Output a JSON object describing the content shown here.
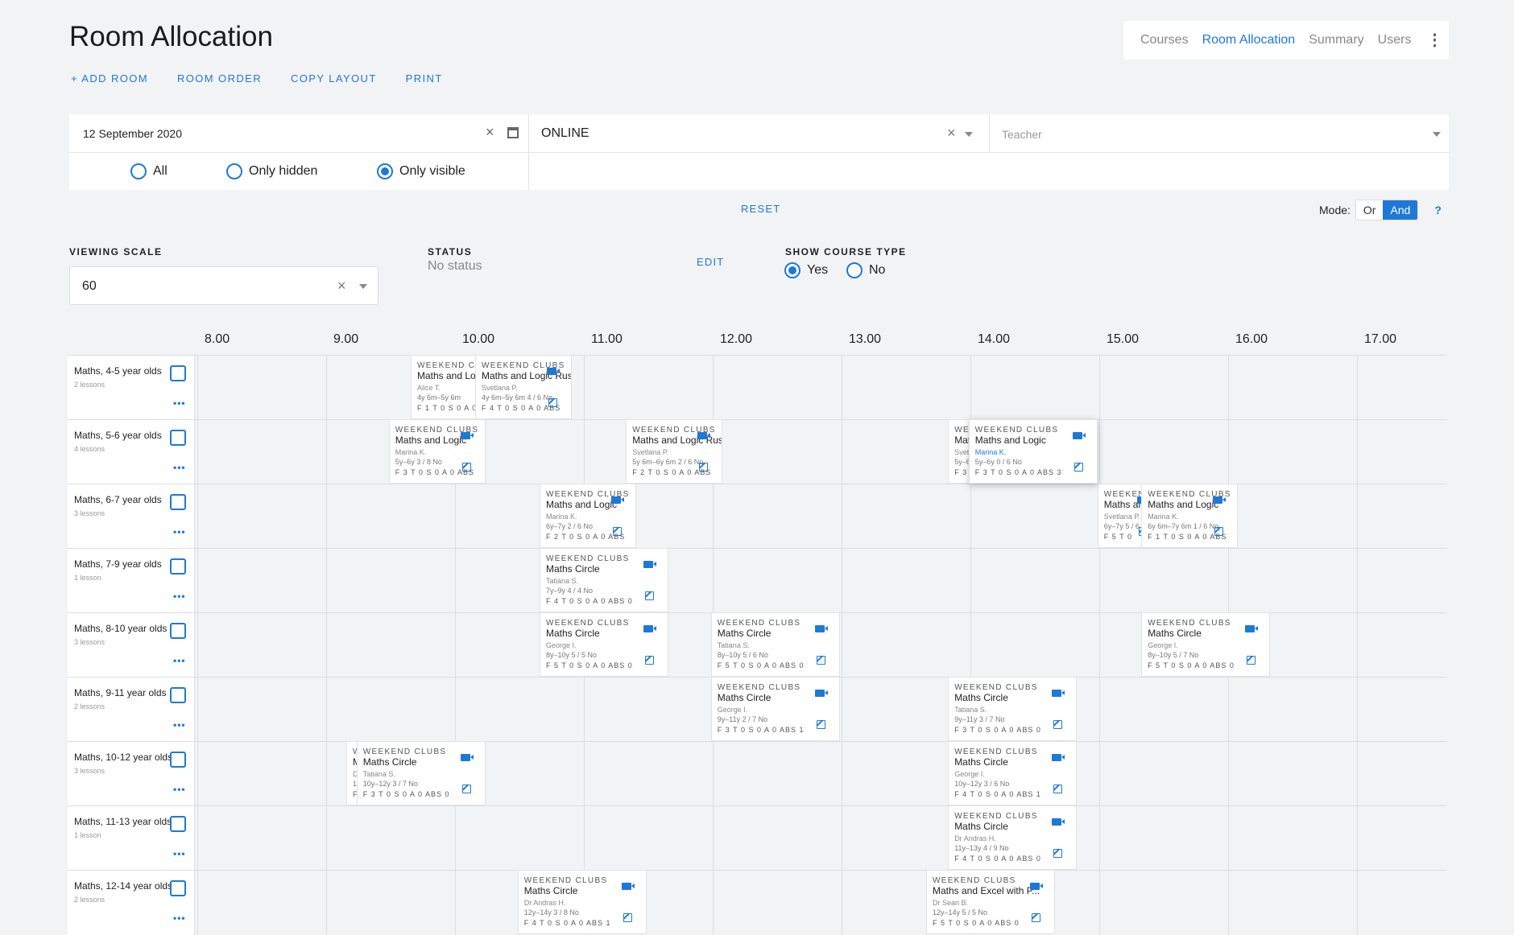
{
  "page": {
    "title": "Room Allocation"
  },
  "actions": [
    "+ ADD ROOM",
    "ROOM ORDER",
    "COPY LAYOUT",
    "PRINT"
  ],
  "nav": {
    "items": [
      "Courses",
      "Room Allocation",
      "Summary",
      "Users"
    ],
    "active": "Room Allocation"
  },
  "filters": {
    "date": "12 September 2020",
    "room": "ONLINE",
    "teacher_placeholder": "Teacher",
    "visibility": {
      "options": [
        "All",
        "Only hidden",
        "Only visible"
      ],
      "selected": "Only visible"
    }
  },
  "reset_label": "RESET",
  "mode": {
    "label": "Mode:",
    "options": [
      "Or",
      "And"
    ],
    "selected": "And",
    "help": "?"
  },
  "viewing_scale": {
    "label": "VIEWING SCALE",
    "value": "60"
  },
  "status": {
    "label": "STATUS",
    "value": "No status",
    "edit": "EDIT"
  },
  "show_course_type": {
    "label": "SHOW COURSE TYPE",
    "options": [
      "Yes",
      "No"
    ],
    "selected": "Yes"
  },
  "hours": [
    "8.00",
    "9.00",
    "10.00",
    "11.00",
    "12.00",
    "13.00",
    "14.00",
    "15.00",
    "16.00",
    "17.00"
  ],
  "rows": [
    {
      "name": "Maths, 4-5 year olds",
      "lessons": "2 lessons"
    },
    {
      "name": "Maths, 5-6 year olds",
      "lessons": "4 lessons"
    },
    {
      "name": "Maths, 6-7 year olds",
      "lessons": "3 lessons"
    },
    {
      "name": "Maths, 7-9 year olds",
      "lessons": "1 lesson"
    },
    {
      "name": "Maths, 8-10 year olds",
      "lessons": "3 lessons"
    },
    {
      "name": "Maths, 9-11 year olds",
      "lessons": "2 lessons"
    },
    {
      "name": "Maths, 10-12 year olds",
      "lessons": "3 lessons"
    },
    {
      "name": "Maths, 11-13 year olds",
      "lessons": "1 lesson"
    },
    {
      "name": "Maths, 12-14 year olds",
      "lessons": "2 lessons"
    }
  ],
  "lessons": [
    {
      "row": 0,
      "start": 9.5,
      "end": 10.25,
      "type": "WEEKEND CLUBS",
      "course": "Maths and Logic",
      "teacher": "Alice T.",
      "ages": "4y 6m–5y 6m",
      "stats": "F 1  T 0  S 0  A 0"
    },
    {
      "row": 0,
      "start": 10.0,
      "end": 10.75,
      "type": "WEEKEND CLUBS",
      "course": "Maths and Logic Rus",
      "teacher": "Svetlana P.",
      "ages": "4y 6m–5y 6m   4 / 6   No",
      "stats": "F 4  T 0  S 0  A 0  ABS"
    },
    {
      "row": 1,
      "start": 9.33,
      "end": 10.08,
      "type": "WEEKEND CLUBS",
      "course": "Maths and Logic",
      "teacher": "Marina K.",
      "ages": "5y–6y   3 / 8   No",
      "stats": "F 3  T 0  S 0  A 0  ABS"
    },
    {
      "row": 1,
      "start": 11.17,
      "end": 11.92,
      "type": "WEEKEND CLUBS",
      "course": "Maths and Logic Rus",
      "teacher": "Svetlana P.",
      "ages": "5y 6m–6y 6m   2 / 6   No",
      "stats": "F 2  T 0  S 0  A 0  ABS"
    },
    {
      "row": 1,
      "start": 13.67,
      "end": 14.42,
      "type": "WEEKEND CLUBS",
      "course": "Maths and Logic",
      "teacher": "Svetlana P.",
      "ages": "5y–6y",
      "stats": "F 3"
    },
    {
      "row": 1,
      "start": 13.83,
      "end": 14.83,
      "type": "WEEKEND CLUBS",
      "course": "Maths and Logic",
      "teacher": "Marina K.",
      "ages": "5y–6y   0 / 6   No",
      "stats": "F 3  T 0  S 0  A 0  ABS 3",
      "highlight": true
    },
    {
      "row": 2,
      "start": 10.5,
      "end": 11.25,
      "type": "WEEKEND CLUBS",
      "course": "Maths and Logic",
      "teacher": "Marina K.",
      "ages": "6y–7y   2 / 6   No",
      "stats": "F 2  T 0  S 0  A 0  ABS"
    },
    {
      "row": 2,
      "start": 14.83,
      "end": 15.33,
      "type": "WEEKEND CLUBS",
      "course": "Maths and Logic",
      "teacher": "Svetlana P.",
      "ages": "6y–7y   5 / 6",
      "stats": "F 5  T 0"
    },
    {
      "row": 2,
      "start": 15.17,
      "end": 15.92,
      "type": "WEEKEND CLUBS",
      "course": "Maths and Logic",
      "teacher": "Marina K.",
      "ages": "6y 6m–7y 6m   1 / 6   No",
      "stats": "F 1  T 0  S 0  A 0  ABS"
    },
    {
      "row": 3,
      "start": 10.5,
      "end": 11.5,
      "type": "WEEKEND CLUBS",
      "course": "Maths Circle",
      "teacher": "Tatiana S.",
      "ages": "7y–9y   4 / 4   No",
      "stats": "F 4  T 0  S 0  A 0  ABS 0"
    },
    {
      "row": 4,
      "start": 10.5,
      "end": 11.5,
      "type": "WEEKEND CLUBS",
      "course": "Maths Circle",
      "teacher": "George I.",
      "ages": "8y–10y   5 / 5   No",
      "stats": "F 5  T 0  S 0  A 0  ABS 0"
    },
    {
      "row": 4,
      "start": 11.83,
      "end": 12.83,
      "type": "WEEKEND CLUBS",
      "course": "Maths Circle",
      "teacher": "Tatiana S.",
      "ages": "8y–10y   5 / 6   No",
      "stats": "F 5  T 0  S 0  A 0  ABS 0"
    },
    {
      "row": 4,
      "start": 15.17,
      "end": 16.17,
      "type": "WEEKEND CLUBS",
      "course": "Maths Circle",
      "teacher": "George I.",
      "ages": "8y–10y   5 / 7   No",
      "stats": "F 5  T 0  S 0  A 0  ABS 0"
    },
    {
      "row": 5,
      "start": 11.83,
      "end": 12.83,
      "type": "WEEKEND CLUBS",
      "course": "Maths Circle",
      "teacher": "George I.",
      "ages": "9y–11y   2 / 7   No",
      "stats": "F 3  T 0  S 0  A 0  ABS 1"
    },
    {
      "row": 5,
      "start": 13.67,
      "end": 14.67,
      "type": "WEEKEND CLUBS",
      "course": "Maths Circle",
      "teacher": "Tatiana S.",
      "ages": "9y–11y   3 / 7   No",
      "stats": "F 3  T 0  S 0  A 0  ABS 0"
    },
    {
      "row": 6,
      "start": 9.0,
      "end": 9.5,
      "type": "WEEKEND CLUBS",
      "course": "Maths Circle",
      "teacher": "Dr Andras H.",
      "ages": "10y–12y",
      "stats": "F"
    },
    {
      "row": 6,
      "start": 9.08,
      "end": 10.08,
      "type": "WEEKEND CLUBS",
      "course": "Maths Circle",
      "teacher": "Tatiana S.",
      "ages": "10y–12y   3 / 7   No",
      "stats": "F 3  T 0  S 0  A 0  ABS 0"
    },
    {
      "row": 6,
      "start": 13.67,
      "end": 14.67,
      "type": "WEEKEND CLUBS",
      "course": "Maths Circle",
      "teacher": "George I.",
      "ages": "10y–12y   3 / 6   No",
      "stats": "F 4  T 0  S 0  A 0  ABS 1"
    },
    {
      "row": 7,
      "start": 13.67,
      "end": 14.67,
      "type": "WEEKEND CLUBS",
      "course": "Maths Circle",
      "teacher": "Dr Andras H.",
      "ages": "11y–13y   4 / 9   No",
      "stats": "F 4  T 0  S 0  A 0  ABS 0"
    },
    {
      "row": 8,
      "start": 10.33,
      "end": 11.33,
      "type": "WEEKEND CLUBS",
      "course": "Maths Circle",
      "teacher": "Dr Andras H.",
      "ages": "12y–14y   3 / 8   No",
      "stats": "F 4  T 0  S 0  A 0  ABS 1"
    },
    {
      "row": 8,
      "start": 13.5,
      "end": 14.5,
      "type": "WEEKEND CLUBS",
      "course": "Maths and Excel with P...",
      "teacher": "Dr Sean B.",
      "ages": "12y–14y   5 / 5   No",
      "stats": "F 5  T 0  S 0  A 0  ABS 0"
    }
  ]
}
